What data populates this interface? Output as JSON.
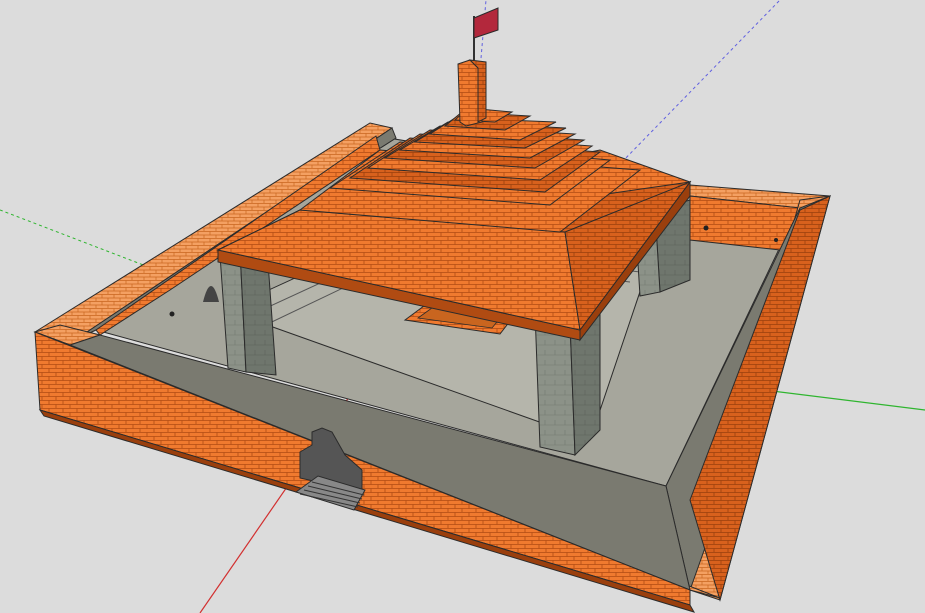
{
  "app": {
    "view": "3d-model-viewport",
    "model": "walled-temple-with-pyramidal-roof"
  },
  "colors": {
    "background": "#dcdcdc",
    "brick": "#f07a2f",
    "brick_dark": "#d8611d",
    "brick_light": "#f4a062",
    "mortar": "#b04b12",
    "floor": "#a6a69c",
    "pillar": "#8c9288",
    "pillar_dark": "#6f766d",
    "flag": "#b3283c",
    "outline": "#2b2b2b",
    "axis_red": "#d23030",
    "axis_green": "#2fb52f",
    "axis_blue": "#6060e0"
  },
  "icons": {
    "flag": "flag-icon",
    "axis": "axis-icon"
  }
}
